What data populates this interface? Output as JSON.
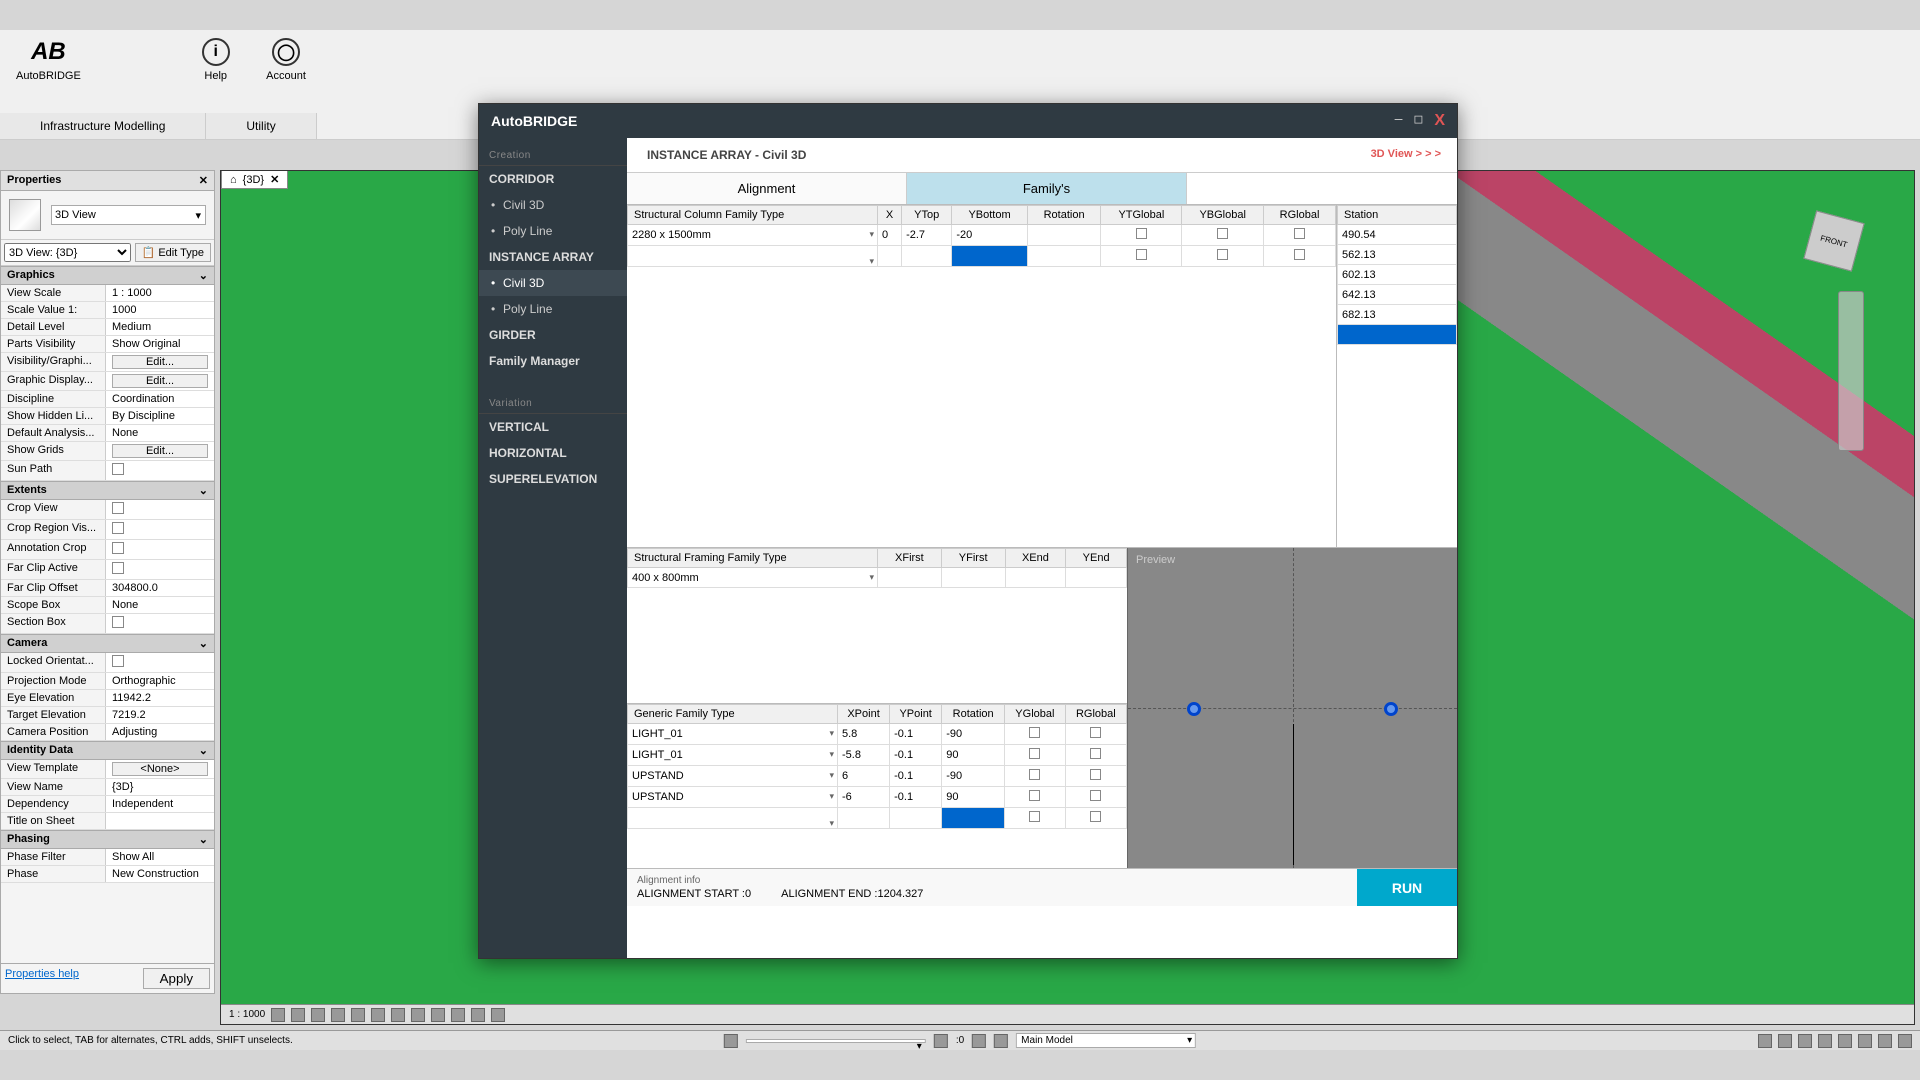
{
  "ribbon": {
    "app_name": "AutoBRIDGE",
    "help": "Help",
    "account": "Account",
    "tab_infra": "Infrastructure Modelling",
    "tab_utility": "Utility"
  },
  "properties": {
    "title": "Properties",
    "view_type": "3D View",
    "view_dropdown": "3D View: {3D}",
    "edit_type": "Edit Type",
    "sections": {
      "graphics": "Graphics",
      "extents": "Extents",
      "camera": "Camera",
      "identity": "Identity Data",
      "phasing": "Phasing"
    },
    "rows": {
      "view_scale": {
        "label": "View Scale",
        "value": "1 : 1000"
      },
      "scale_value": {
        "label": "Scale Value    1:",
        "value": "1000"
      },
      "detail_level": {
        "label": "Detail Level",
        "value": "Medium"
      },
      "parts_vis": {
        "label": "Parts Visibility",
        "value": "Show Original"
      },
      "vis_graphics": {
        "label": "Visibility/Graphi...",
        "value": "Edit..."
      },
      "graphic_disp": {
        "label": "Graphic Display...",
        "value": "Edit..."
      },
      "discipline": {
        "label": "Discipline",
        "value": "Coordination"
      },
      "show_hidden": {
        "label": "Show Hidden Li...",
        "value": "By Discipline"
      },
      "default_analysis": {
        "label": "Default Analysis...",
        "value": "None"
      },
      "show_grids": {
        "label": "Show Grids",
        "value": "Edit..."
      },
      "sun_path": {
        "label": "Sun Path",
        "value": ""
      },
      "crop_view": {
        "label": "Crop View",
        "value": ""
      },
      "crop_region": {
        "label": "Crop Region Vis...",
        "value": ""
      },
      "annotation_crop": {
        "label": "Annotation Crop",
        "value": ""
      },
      "far_clip_active": {
        "label": "Far Clip Active",
        "value": ""
      },
      "far_clip_offset": {
        "label": "Far Clip Offset",
        "value": "304800.0"
      },
      "scope_box": {
        "label": "Scope Box",
        "value": "None"
      },
      "section_box": {
        "label": "Section Box",
        "value": ""
      },
      "locked_orient": {
        "label": "Locked Orientat...",
        "value": ""
      },
      "projection": {
        "label": "Projection Mode",
        "value": "Orthographic"
      },
      "eye_elev": {
        "label": "Eye Elevation",
        "value": "11942.2"
      },
      "target_elev": {
        "label": "Target Elevation",
        "value": "7219.2"
      },
      "camera_pos": {
        "label": "Camera Position",
        "value": "Adjusting"
      },
      "view_template": {
        "label": "View Template",
        "value": "<None>"
      },
      "view_name": {
        "label": "View Name",
        "value": "{3D}"
      },
      "dependency": {
        "label": "Dependency",
        "value": "Independent"
      },
      "title_sheet": {
        "label": "Title on Sheet",
        "value": ""
      },
      "phase_filter": {
        "label": "Phase Filter",
        "value": "Show All"
      },
      "phase": {
        "label": "Phase",
        "value": "New Construction"
      }
    },
    "help_link": "Properties help",
    "apply": "Apply"
  },
  "viewport": {
    "tab_name": "{3D}",
    "scale": "1 : 1000",
    "cube_face": "FRONT"
  },
  "dialog": {
    "title": "AutoBRIDGE",
    "subtitle": "INSTANCE ARRAY - Civil 3D",
    "view3d": "3D View > > >",
    "tabs": {
      "alignment": "Alignment",
      "familys": "Family's"
    },
    "sidebar": {
      "creation": "Creation",
      "corridor": "CORRIDOR",
      "civil3d": "Civil 3D",
      "polyline": "Poly Line",
      "instance_array": "INSTANCE ARRAY",
      "girder": "GIRDER",
      "family_mgr": "Family Manager",
      "variation": "Variation",
      "vertical": "VERTICAL",
      "horizontal": "HORIZONTAL",
      "superelevation": "SUPERELEVATION"
    },
    "col_headers": {
      "struct_col": "Structural Column Family Type",
      "x": "X",
      "ytop": "YTop",
      "ybottom": "YBottom",
      "rotation": "Rotation",
      "ytglobal": "YTGlobal",
      "ybglobal": "YBGlobal",
      "rglobal": "RGlobal",
      "station": "Station",
      "struct_framing": "Structural Framing Family Type",
      "xfirst": "XFirst",
      "yfirst": "YFirst",
      "xend": "XEnd",
      "yend": "YEnd",
      "generic": "Generic Family Type",
      "xpoint": "XPoint",
      "ypoint": "YPoint",
      "yglobal": "YGlobal"
    },
    "col_row1": {
      "type": "2280 x 1500mm",
      "x": "0",
      "ytop": "-2.7",
      "ybottom": "-20"
    },
    "stations": [
      "490.54",
      "562.13",
      "602.13",
      "642.13",
      "682.13"
    ],
    "framing_row": {
      "type": "400 x 800mm"
    },
    "generic_rows": [
      {
        "type": "LIGHT_01",
        "xp": "5.8",
        "yp": "-0.1",
        "rot": "-90"
      },
      {
        "type": "LIGHT_01",
        "xp": "-5.8",
        "yp": "-0.1",
        "rot": "90"
      },
      {
        "type": "UPSTAND",
        "xp": "6",
        "yp": "-0.1",
        "rot": "-90"
      },
      {
        "type": "UPSTAND",
        "xp": "-6",
        "yp": "-0.1",
        "rot": "90"
      }
    ],
    "preview": "Preview",
    "align_info": "Alignment info",
    "align_start": "ALIGNMENT START :0",
    "align_end": "ALIGNMENT END :1204.327",
    "run": "RUN"
  },
  "statusbar": {
    "hint": "Click to select, TAB for alternates, CTRL adds, SHIFT unselects.",
    "main_model": "Main Model",
    "zero": ":0"
  }
}
